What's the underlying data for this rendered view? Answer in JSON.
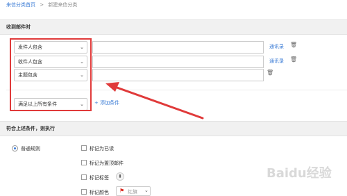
{
  "breadcrumb": {
    "home": "来信分类首页",
    "separator": ">",
    "current": "新建来信分类"
  },
  "receive_section": {
    "title": "收到邮件时",
    "conditions": [
      {
        "select": "发件人包含",
        "value": "",
        "link": "通讯录"
      },
      {
        "select": "收件人包含",
        "value": "",
        "link": "通讯录"
      },
      {
        "select": "主题包含",
        "value": ""
      }
    ],
    "match_select": "满足以上所有条件",
    "add_condition": "添加条件"
  },
  "action_section": {
    "title": "符合上述条件，则执行",
    "rule_type": "普通规则",
    "actions": [
      {
        "label": "标记为已读"
      },
      {
        "label": "标记为置顶邮件"
      },
      {
        "label": "标记标签"
      },
      {
        "label": "标记颜色",
        "color_value": "红旗"
      }
    ]
  },
  "watermark": "Baidu经验",
  "colors": {
    "accent": "#3a7bd5",
    "annotation_red": "#e03a3a",
    "flag_red": "#d9261c"
  },
  "icons": [
    "trash-icon",
    "chevron-down-icon",
    "flag-icon",
    "tag-icon",
    "annotation-arrow"
  ]
}
